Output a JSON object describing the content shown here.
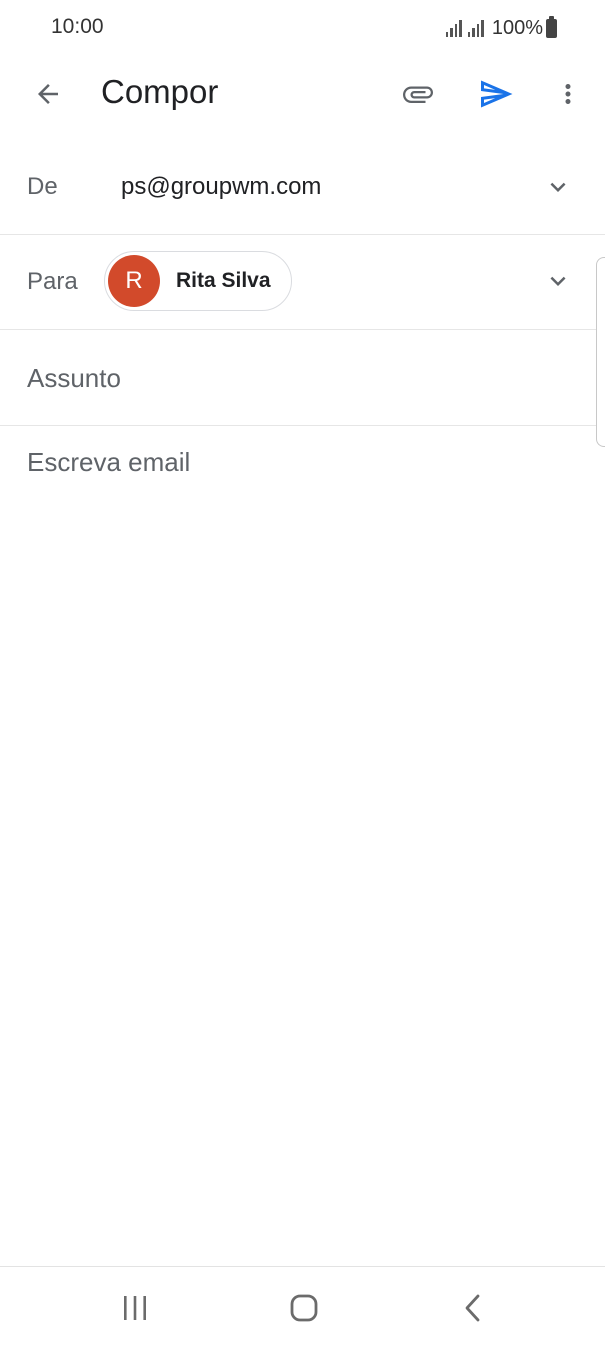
{
  "status_bar": {
    "time": "10:00",
    "battery": "100%"
  },
  "app_bar": {
    "title": "Compor",
    "icons": {
      "back": "arrow-left-icon",
      "attach": "paperclip-icon",
      "send": "send-icon",
      "more": "more-vert-icon"
    },
    "accent_color": "#1a73e8"
  },
  "compose": {
    "from": {
      "label": "De",
      "value": "ps@groupwm.com"
    },
    "to": {
      "label": "Para",
      "recipients": [
        {
          "initial": "R",
          "name": "Rita Silva",
          "avatar_color": "#d24a2b"
        }
      ]
    },
    "subject": {
      "value": "",
      "placeholder": "Assunto"
    },
    "body": {
      "value": "",
      "placeholder": "Escreva email"
    }
  },
  "nav_bar": {
    "icons": [
      "recents-icon",
      "home-icon",
      "back-icon"
    ]
  }
}
